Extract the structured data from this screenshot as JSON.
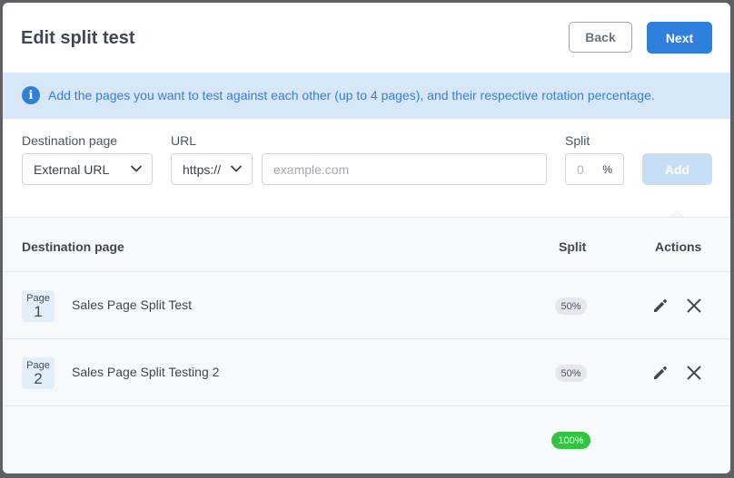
{
  "modal": {
    "title": "Edit split test",
    "back_label": "Back",
    "next_label": "Next"
  },
  "info": {
    "icon": "info-icon",
    "text": "Add the pages you want to test against each other (up to 4 pages), and their respective rotation percentage."
  },
  "form": {
    "destination_label": "Destination page",
    "destination_value": "External URL",
    "url_label": "URL",
    "protocol_value": "https://",
    "url_placeholder": "example.com",
    "split_label": "Split",
    "split_value": "0",
    "split_unit": "%",
    "add_label": "Add"
  },
  "table": {
    "headers": {
      "destination": "Destination page",
      "split": "Split",
      "actions": "Actions"
    },
    "rows": [
      {
        "page_word": "Page",
        "page_number": "1",
        "name": "Sales Page Split Test",
        "split": "50%"
      },
      {
        "page_word": "Page",
        "page_number": "2",
        "name": "Sales Page Split Testing 2",
        "split": "50%"
      }
    ],
    "total": "100%"
  },
  "colors": {
    "primary": "#2f80dd",
    "info_bg": "#d8e7f7",
    "total_badge": "#2fc53d",
    "add_disabled": "#c7def7"
  }
}
